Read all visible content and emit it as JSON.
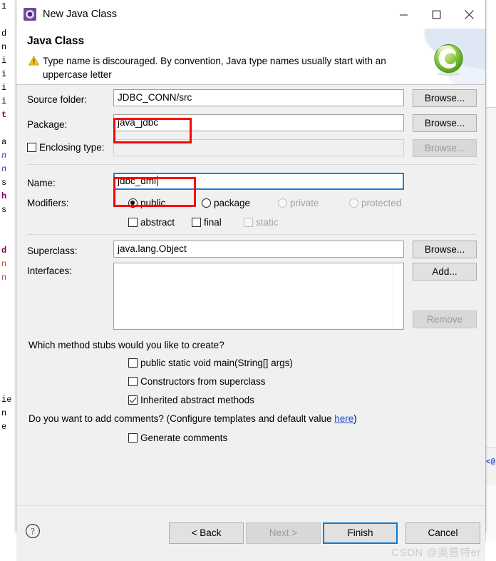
{
  "window": {
    "title": "New Java Class",
    "icon": "java-class-wizard-icon",
    "controls": {
      "minimize": "minimize-icon",
      "maximize": "maximize-icon",
      "close": "close-icon"
    }
  },
  "header": {
    "title": "Java Class",
    "warning_icon": "warning-triangle-icon",
    "message_line1": "Type name is discouraged. By convention, Java type names usually start with an",
    "message_line2": "uppercase letter",
    "logo": "eclipse-c-logo-icon"
  },
  "form": {
    "source_folder": {
      "label": "Source folder:",
      "label_mnemonic_index": 11,
      "value": "JDBC_CONN/src",
      "browse": "Browse..."
    },
    "package": {
      "label": "Package:",
      "value": "java_jdbc",
      "browse": "Browse...",
      "annotated": true
    },
    "enclosing_type": {
      "label": "Enclosing type:",
      "checked": false,
      "value": "",
      "browse": "Browse...",
      "disabled": true
    },
    "name": {
      "label": "Name:",
      "value": "jdbc_dml",
      "focused": true,
      "annotated": true
    },
    "modifiers": {
      "label": "Modifiers:",
      "radios": [
        {
          "label": "public",
          "selected": true,
          "disabled": false
        },
        {
          "label": "package",
          "selected": false,
          "disabled": false
        },
        {
          "label": "private",
          "selected": false,
          "disabled": true
        },
        {
          "label": "protected",
          "selected": false,
          "disabled": true
        }
      ],
      "checkboxes": [
        {
          "label": "abstract",
          "checked": false,
          "disabled": false
        },
        {
          "label": "final",
          "checked": false,
          "disabled": false
        },
        {
          "label": "static",
          "checked": false,
          "disabled": true
        }
      ]
    },
    "superclass": {
      "label": "Superclass:",
      "value": "java.lang.Object",
      "browse": "Browse..."
    },
    "interfaces": {
      "label": "Interfaces:",
      "items": [],
      "add": "Add...",
      "remove": "Remove",
      "remove_disabled": true
    },
    "stubs": {
      "question": "Which method stubs would you like to create?",
      "options": [
        {
          "label": "public static void main(String[] args)",
          "checked": false
        },
        {
          "label": "Constructors from superclass",
          "checked": false
        },
        {
          "label": "Inherited abstract methods",
          "checked": true
        }
      ]
    },
    "comments": {
      "question_pre": "Do you want to add comments? (Configure templates and default value ",
      "link": "here",
      "question_post": ")",
      "option": {
        "label": "Generate comments",
        "checked": false
      }
    }
  },
  "footer": {
    "help_icon": "help-question-icon",
    "buttons": [
      {
        "name": "back",
        "label": "< Back",
        "disabled": false,
        "default": false
      },
      {
        "name": "next",
        "label": "Next >",
        "disabled": true,
        "default": false
      },
      {
        "name": "finish",
        "label": "Finish",
        "disabled": false,
        "default": true
      },
      {
        "name": "cancel",
        "label": "Cancel",
        "disabled": false,
        "default": false
      }
    ]
  },
  "watermark": "CSDN @奥普特er",
  "background_code": {
    "left_lines": [
      "1",
      "",
      "d",
      "n",
      "i",
      "i",
      "i",
      "i",
      "t",
      "",
      "a",
      "n",
      "n",
      "s",
      "h",
      "s",
      "",
      "",
      "d",
      "n",
      "n",
      "",
      "",
      "",
      "",
      "",
      "",
      "",
      "ie",
      "n",
      "e"
    ],
    "right_marker": "<@"
  },
  "colors": {
    "annotation": "#fd0000",
    "focus_border": "#1c7fd6",
    "default_button_border": "#0b7ad1",
    "link": "#1a4fd0",
    "dialog_bg": "#f0f0f0",
    "title_icon": "#6f4a9e",
    "logo_green": "#7bc043"
  }
}
